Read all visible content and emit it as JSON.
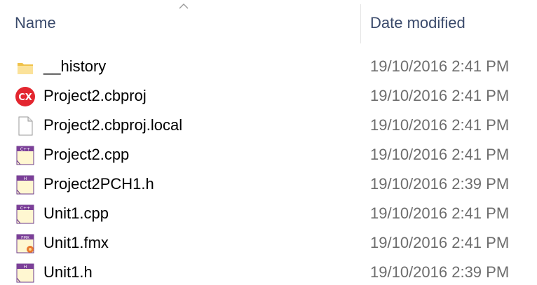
{
  "header": {
    "name_label": "Name",
    "date_label": "Date modified"
  },
  "files": [
    {
      "name": "__history",
      "date": "19/10/2016 2:41 PM",
      "icon": "folder-icon"
    },
    {
      "name": "Project2.cbproj",
      "date": "19/10/2016 2:41 PM",
      "icon": "cbproj-icon"
    },
    {
      "name": "Project2.cbproj.local",
      "date": "19/10/2016 2:41 PM",
      "icon": "blank-file-icon"
    },
    {
      "name": "Project2.cpp",
      "date": "19/10/2016 2:41 PM",
      "icon": "cpp-file-icon",
      "icon_tag": "C++"
    },
    {
      "name": "Project2PCH1.h",
      "date": "19/10/2016 2:39 PM",
      "icon": "h-file-icon",
      "icon_tag": "H"
    },
    {
      "name": "Unit1.cpp",
      "date": "19/10/2016 2:41 PM",
      "icon": "cpp-file-icon",
      "icon_tag": "C++"
    },
    {
      "name": "Unit1.fmx",
      "date": "19/10/2016 2:41 PM",
      "icon": "fmx-file-icon",
      "icon_tag": "FMX"
    },
    {
      "name": "Unit1.h",
      "date": "19/10/2016 2:39 PM",
      "icon": "h-file-icon",
      "icon_tag": "H"
    }
  ],
  "colors": {
    "header_text": "#3a4a6b",
    "date_text": "#6d6d6d",
    "folder": "#f7d774",
    "cbproj_red": "#e3262f",
    "code_purple": "#7b3f98",
    "code_page": "#fff7d1"
  }
}
